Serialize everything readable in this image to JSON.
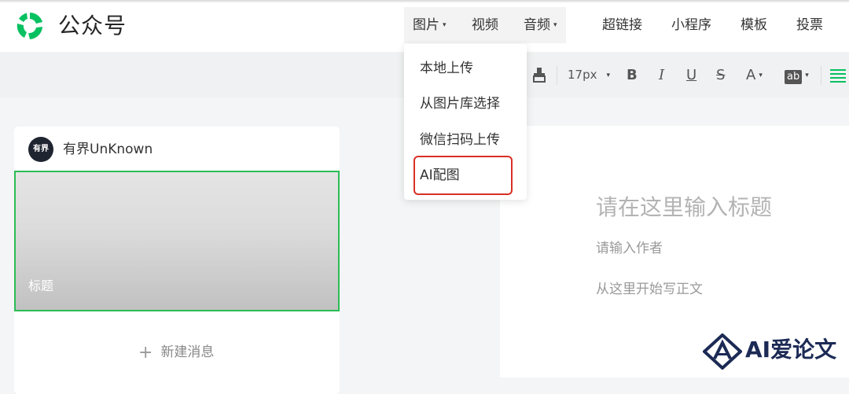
{
  "header": {
    "brand": "公众号",
    "tabs": [
      {
        "label": "图片",
        "has_caret": true
      },
      {
        "label": "视频",
        "has_caret": false
      },
      {
        "label": "音频",
        "has_caret": true
      },
      {
        "label": "超链接",
        "has_caret": false
      },
      {
        "label": "小程序",
        "has_caret": false
      },
      {
        "label": "模板",
        "has_caret": false
      },
      {
        "label": "投票",
        "has_caret": false
      }
    ]
  },
  "format_toolbar": {
    "font_size": "17px",
    "bold": "B",
    "italic": "I",
    "underline": "U",
    "strikethrough": "S",
    "font_color": "A",
    "background_color": "ab"
  },
  "image_menu": {
    "items": [
      "本地上传",
      "从图片库选择",
      "微信扫码上传",
      "AI配图"
    ],
    "highlighted": "AI配图",
    "highlight_color": "#d93025"
  },
  "article_card": {
    "account_name": "有界UnKnown",
    "avatar_text": "有界",
    "cover_title": "标题",
    "new_message": "新建消息",
    "selection_color": "#2bbd55"
  },
  "editor": {
    "title_placeholder": "请在这里输入标题",
    "author_placeholder": "请输入作者",
    "body_placeholder": "从这里开始写正文"
  },
  "watermark": {
    "text": "AI爱论文"
  },
  "colors": {
    "brand_green": "#07c160",
    "accent_green": "#2bbd55"
  }
}
